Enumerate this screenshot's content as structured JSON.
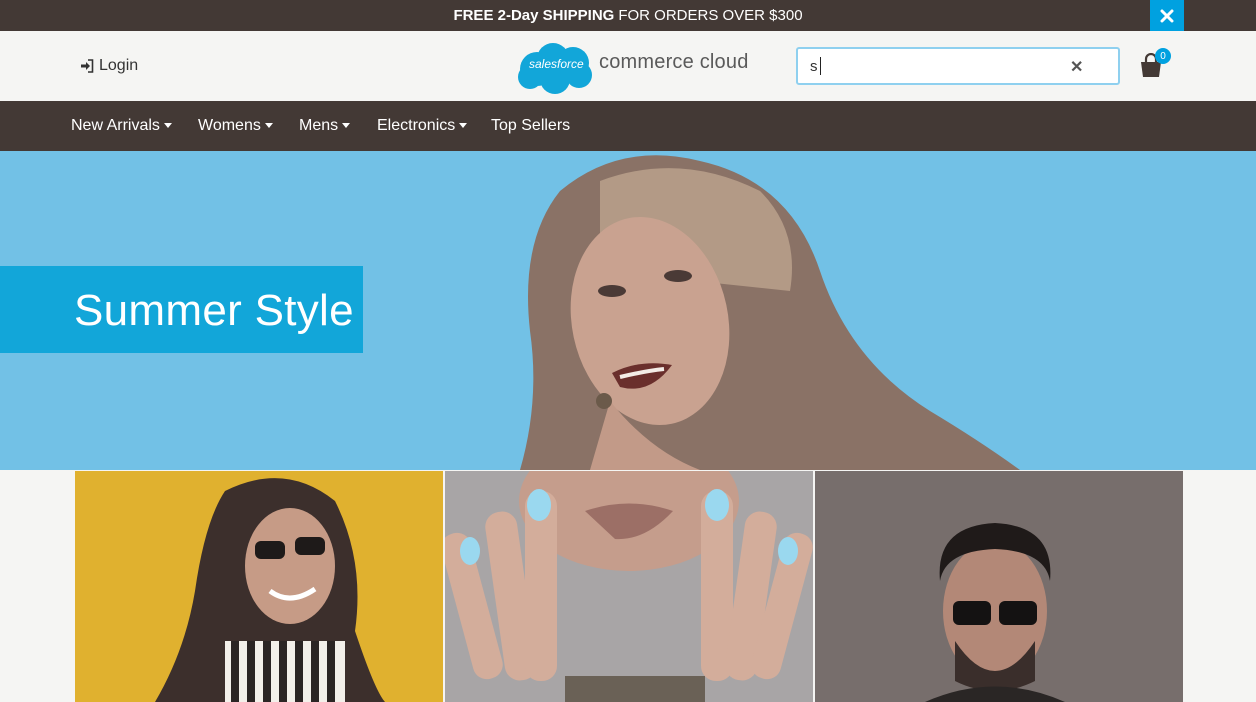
{
  "promo": {
    "bold_text": "FREE 2-Day SHIPPING",
    "text": "FOR ORDERS OVER $300",
    "close_icon": "close-icon"
  },
  "header": {
    "login_label": "Login",
    "logo_salesforce": "salesforce",
    "logo_commerce": "commerce cloud",
    "search_value": "s",
    "cart_count": "0"
  },
  "nav": {
    "items": [
      {
        "label": "New Arrivals",
        "has_menu": true
      },
      {
        "label": "Womens",
        "has_menu": true
      },
      {
        "label": "Mens",
        "has_menu": true
      },
      {
        "label": "Electronics",
        "has_menu": true
      },
      {
        "label": "Top Sellers",
        "has_menu": false
      }
    ]
  },
  "hero": {
    "title": "Summer Style"
  },
  "colors": {
    "brand_dark": "#433935",
    "accent_blue": "#00a1e0",
    "hero_bg": "#72c1e6",
    "tile_yellow": "#e0b12f",
    "tile_gray": "#776e6c"
  }
}
